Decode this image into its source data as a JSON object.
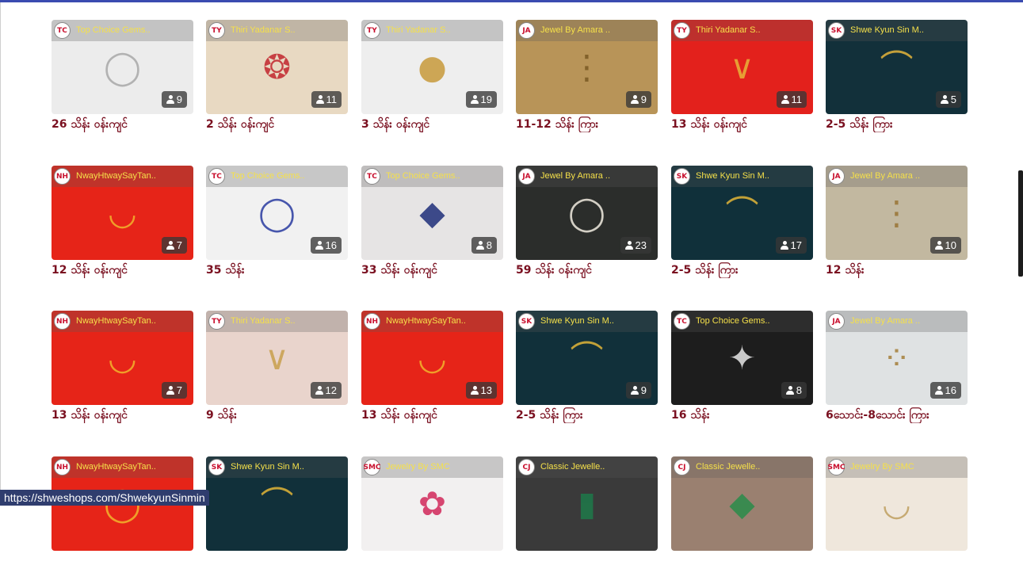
{
  "status_url": "https://shweshops.com/ShwekyunSinmin",
  "colors": {
    "accent_bar": "#3a4bb0",
    "title_text": "#7a1020",
    "shop_text": "#f5e04a"
  },
  "products": [
    {
      "shop": "Top Choice Gems..",
      "logo": "TC",
      "title": "26 သိန်း ဝန်းကျင်",
      "count": "9",
      "bg": "#ececec",
      "fg": "#a8a8a8",
      "glyph": "◯"
    },
    {
      "shop": "Thiri Yadanar S..",
      "logo": "TY",
      "title": "2 သိန်း ဝန်းကျင်",
      "count": "11",
      "bg": "#e8d9c2",
      "fg": "#c2262d",
      "glyph": "❂"
    },
    {
      "shop": "Thiri Yadanar S..",
      "logo": "TY",
      "title": "3 သိန်း ဝန်းကျင်",
      "count": "19",
      "bg": "#eeeeee",
      "fg": "#c89a3b",
      "glyph": "●"
    },
    {
      "shop": "Jewel By Amara ..",
      "logo": "JA",
      "title": "11-12 သိန်း ကြား",
      "count": "9",
      "bg": "#b89458",
      "fg": "#7a5a24",
      "glyph": "⋮"
    },
    {
      "shop": "Thiri Yadanar S..",
      "logo": "TY",
      "title": "13 သိန်း ဝန်းကျင်",
      "count": "11",
      "bg": "#e3211c",
      "fg": "#e8b339",
      "glyph": "∨"
    },
    {
      "shop": "Shwe Kyun Sin M..",
      "logo": "SK",
      "title": "2-5 သိန်း ကြား",
      "count": "5",
      "bg": "#12303a",
      "fg": "#e4b43a",
      "glyph": "⌒"
    },
    {
      "shop": "NwayHtwaySayTan..",
      "logo": "NH",
      "title": "12 သိန်း ဝန်းကျင်",
      "count": "7",
      "bg": "#e62418",
      "fg": "#f2b42c",
      "glyph": "◡"
    },
    {
      "shop": "Top Choice Gems..",
      "logo": "TC",
      "title": "35 သိန်း",
      "count": "16",
      "bg": "#f1f1f1",
      "fg": "#2a3ba0",
      "glyph": "◯"
    },
    {
      "shop": "Top Choice Gems..",
      "logo": "TC",
      "title": "33 သိန်း ဝန်းကျင်",
      "count": "8",
      "bg": "#e6e4e4",
      "fg": "#1f2f7a",
      "glyph": "◆"
    },
    {
      "shop": "Jewel By Amara ..",
      "logo": "JA",
      "title": "59 သိန်း ဝန်းကျင်",
      "count": "23",
      "bg": "#2b2d2b",
      "fg": "#f1ece0",
      "glyph": "◯"
    },
    {
      "shop": "Shwe Kyun Sin M..",
      "logo": "SK",
      "title": "2-5 သိန်း ကြား",
      "count": "17",
      "bg": "#10303a",
      "fg": "#e2b538",
      "glyph": "⌒"
    },
    {
      "shop": "Jewel By Amara ..",
      "logo": "JA",
      "title": "12 သိန်း",
      "count": "10",
      "bg": "#c2b8a0",
      "fg": "#9a7434",
      "glyph": "⋮"
    },
    {
      "shop": "NwayHtwaySayTan..",
      "logo": "NH",
      "title": "13 သိန်း ဝန်းကျင်",
      "count": "7",
      "bg": "#e62418",
      "fg": "#f2b42c",
      "glyph": "◡"
    },
    {
      "shop": "Thiri Yadanar S..",
      "logo": "TY",
      "title": "9 သိန်း",
      "count": "12",
      "bg": "#e9d4cc",
      "fg": "#c9a04c",
      "glyph": "∨"
    },
    {
      "shop": "NwayHtwaySayTan..",
      "logo": "NH",
      "title": "13 သိန်း ဝန်းကျင်",
      "count": "13",
      "bg": "#e62418",
      "fg": "#f2b42c",
      "glyph": "◡"
    },
    {
      "shop": "Shwe Kyun Sin M..",
      "logo": "SK",
      "title": "2-5 သိန်း ကြား",
      "count": "9",
      "bg": "#11303a",
      "fg": "#e2b538",
      "glyph": "⌒"
    },
    {
      "shop": "Top Choice Gems..",
      "logo": "TC",
      "title": "16 သိန်း",
      "count": "8",
      "bg": "#1d1d1d",
      "fg": "#e8e8e8",
      "glyph": "✦"
    },
    {
      "shop": "Jewel By Amara ..",
      "logo": "JA",
      "title": "6သောင်း-8သောင်း ကြား",
      "count": "16",
      "bg": "#dfe2e3",
      "fg": "#a57f3a",
      "glyph": "⁘"
    },
    {
      "shop": "NwayHtwaySayTan..",
      "logo": "NH",
      "title": "",
      "count": "",
      "bg": "#e62418",
      "fg": "#f2b42c",
      "glyph": "◯"
    },
    {
      "shop": "Shwe Kyun Sin M..",
      "logo": "SK",
      "title": "",
      "count": "",
      "bg": "#11303a",
      "fg": "#e2b538",
      "glyph": "⌒"
    },
    {
      "shop": "Jewelry By SMC",
      "logo": "SMC",
      "title": "",
      "count": "",
      "bg": "#f2f0f0",
      "fg": "#d2285a",
      "glyph": "✿"
    },
    {
      "shop": "Classic Jewelle..",
      "logo": "CJ",
      "title": "",
      "count": "",
      "bg": "#3a3a3a",
      "fg": "#1e7a4a",
      "glyph": "▮"
    },
    {
      "shop": "Classic Jewelle..",
      "logo": "CJ",
      "title": "",
      "count": "",
      "bg": "#9a8070",
      "fg": "#2a8c4a",
      "glyph": "◆"
    },
    {
      "shop": "Jewelry By SMC",
      "logo": "SMC",
      "title": "",
      "count": "",
      "bg": "#efe7dc",
      "fg": "#bfa060",
      "glyph": "◡"
    }
  ]
}
